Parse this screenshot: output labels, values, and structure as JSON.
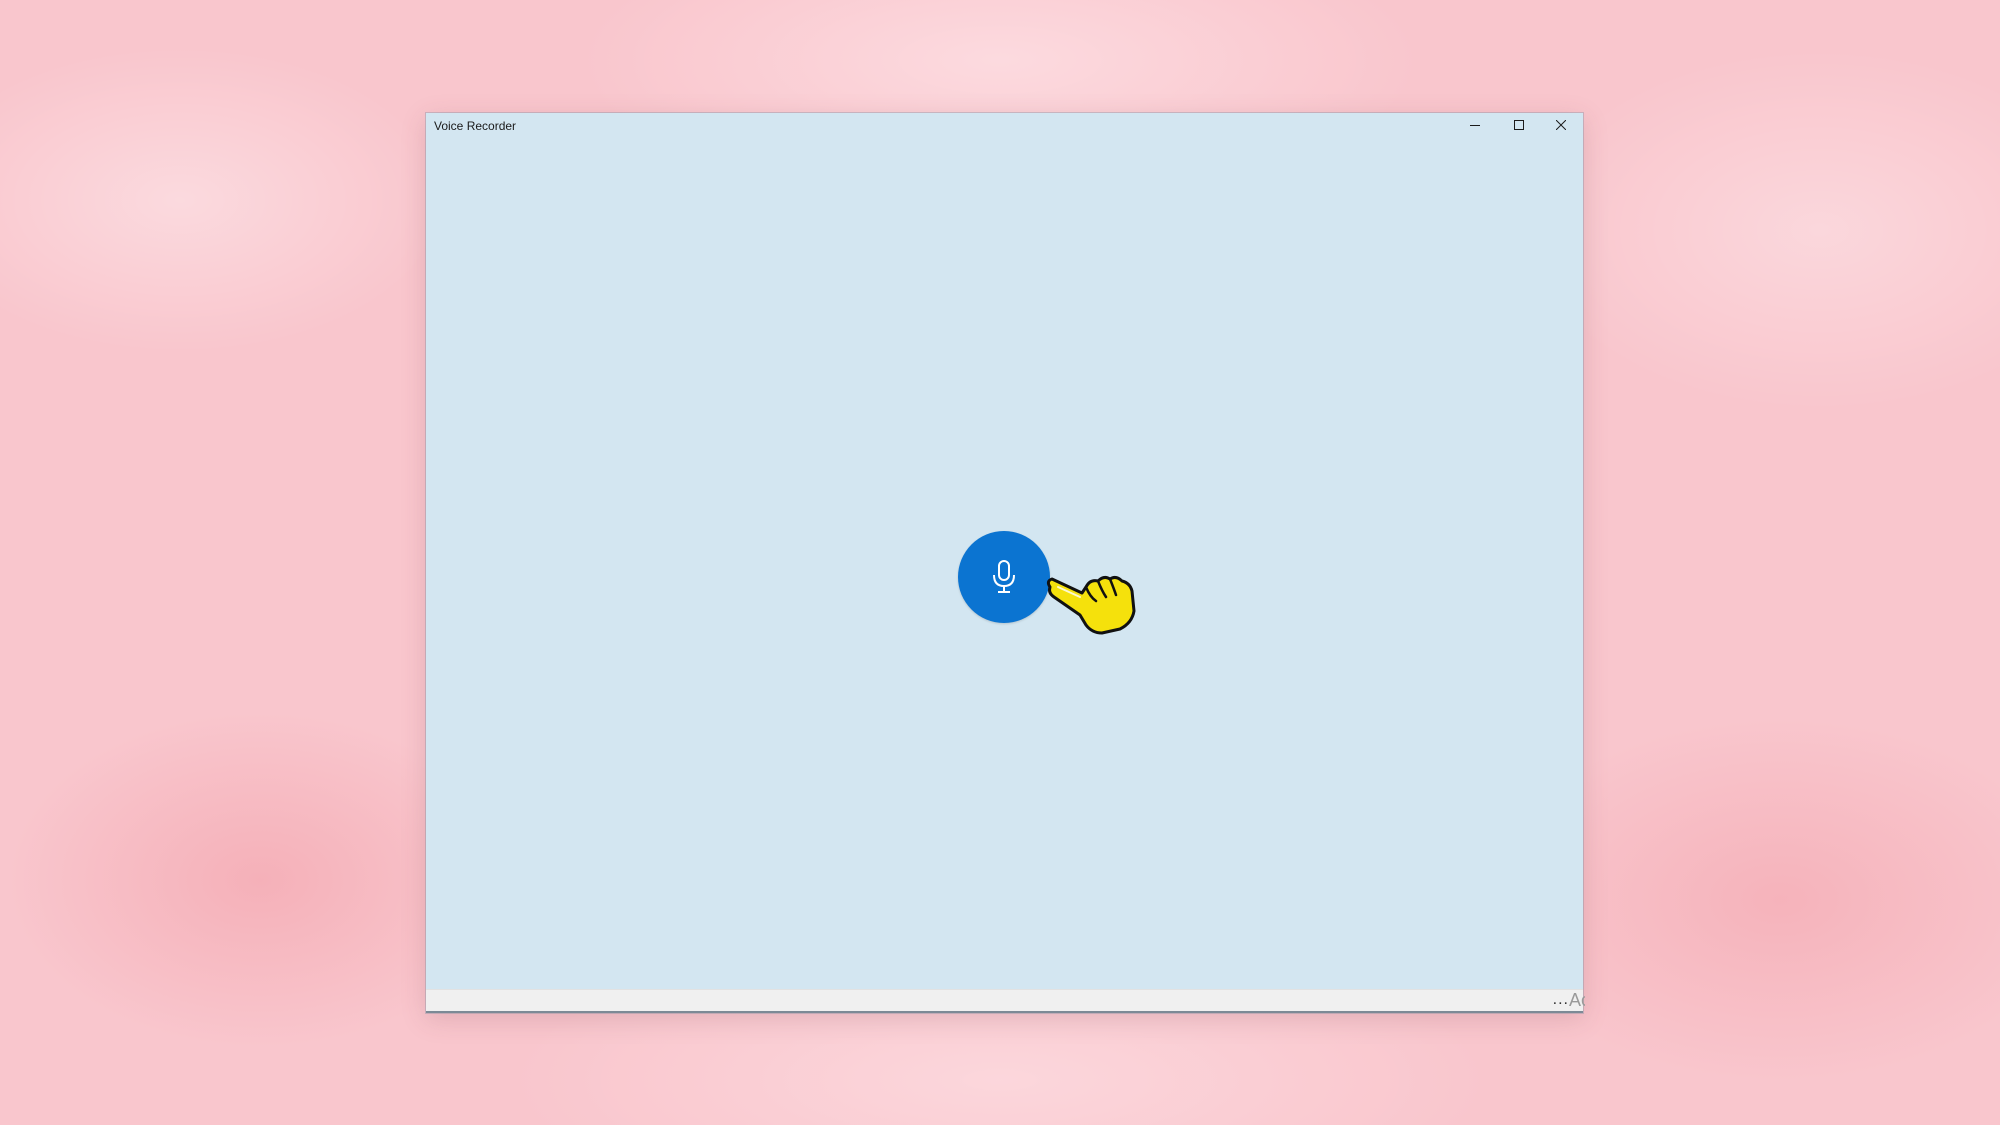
{
  "window": {
    "title": "Voice Recorder",
    "controls": {
      "minimize_icon": "minimize-icon",
      "maximize_icon": "maximize-icon",
      "close_icon": "close-icon"
    }
  },
  "main": {
    "record_button": {
      "icon": "microphone-icon",
      "color": "#0b74d1"
    },
    "pointer": {
      "icon": "pointing-hand-icon",
      "color": "#f5e10c"
    }
  },
  "bottom_bar": {
    "more_label": "...",
    "cut_text": "Ac"
  },
  "colors": {
    "window_background": "#d3e6f1",
    "desktop_background": "#f9c6cd"
  }
}
